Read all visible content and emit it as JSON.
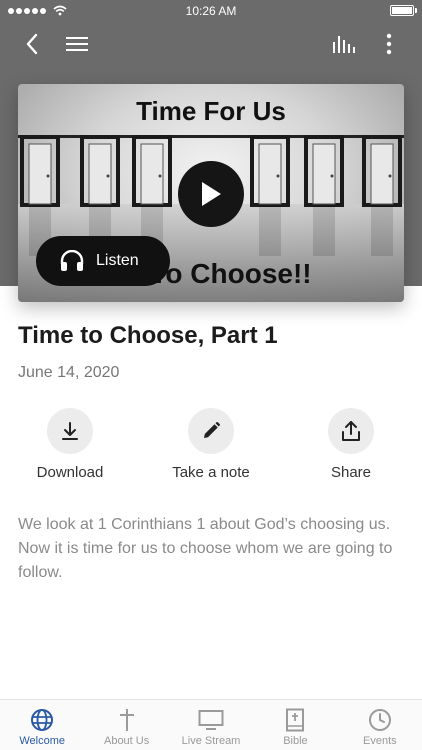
{
  "status_bar": {
    "time": "10:26 AM"
  },
  "media": {
    "art_title": "Time For Us",
    "art_subtitle": "To Choose!!",
    "listen_label": "Listen"
  },
  "sermon": {
    "title": "Time to Choose, Part 1",
    "date": "June 14, 2020",
    "description": "We look at 1 Corinthians 1 about God’s choosing us. Now it is time for us to choose whom we are going to follow."
  },
  "actions": [
    {
      "label": "Download",
      "icon": "download-icon"
    },
    {
      "label": "Take a note",
      "icon": "pencil-icon"
    },
    {
      "label": "Share",
      "icon": "share-icon"
    }
  ],
  "tabs": [
    {
      "label": "Welcome",
      "icon": "globe-icon",
      "active": true
    },
    {
      "label": "About Us",
      "icon": "cross-icon",
      "active": false
    },
    {
      "label": "Live Stream",
      "icon": "monitor-icon",
      "active": false
    },
    {
      "label": "Bible",
      "icon": "bible-icon",
      "active": false
    },
    {
      "label": "Events",
      "icon": "clock-icon",
      "active": false
    }
  ],
  "colors": {
    "header_bg": "#6b6b6b",
    "accent": "#2a5aa4",
    "inactive": "#9a9a9a"
  }
}
